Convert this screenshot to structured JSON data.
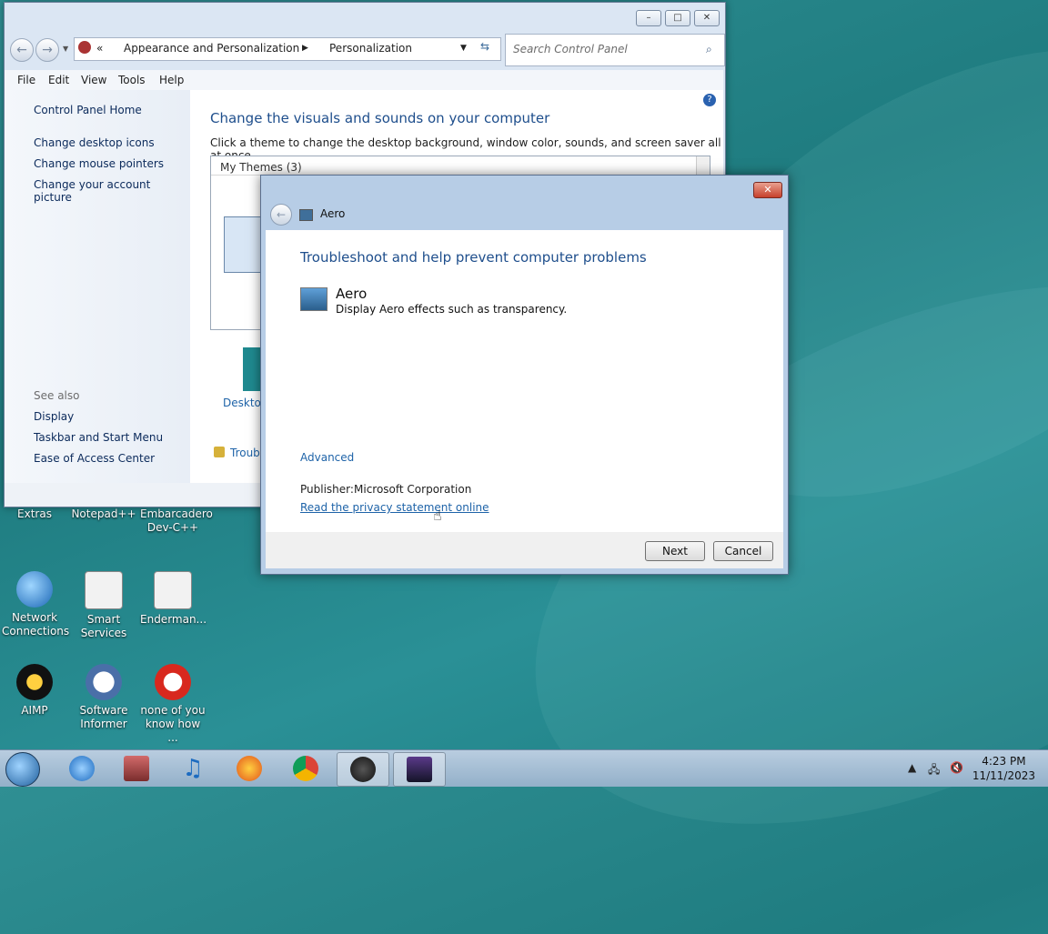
{
  "desktop": {
    "icons": [
      {
        "label": "Extras"
      },
      {
        "label": "Notepad++"
      },
      {
        "label": "Embarcadero Dev-C++"
      },
      {
        "label": "Network Connections"
      },
      {
        "label": "Smart Services"
      },
      {
        "label": "Enderman..."
      },
      {
        "label": "AIMP"
      },
      {
        "label": "Software Informer"
      },
      {
        "label": "none of you know how ..."
      }
    ]
  },
  "control_panel": {
    "address": {
      "crumb1": "Appearance and Personalization",
      "crumb2": "Personalization"
    },
    "search_placeholder": "Search Control Panel",
    "menu": [
      "File",
      "Edit",
      "View",
      "Tools",
      "Help"
    ],
    "left": {
      "home": "Control Panel Home",
      "links": [
        "Change desktop icons",
        "Change mouse pointers",
        "Change your account picture"
      ],
      "see_also_title": "See also",
      "see_also": [
        "Display",
        "Taskbar and Start Menu",
        "Ease of Access Center"
      ]
    },
    "main": {
      "heading": "Change the visuals and sounds on your computer",
      "subtext": "Click a theme to change the desktop background, window color, sounds, and screen saver all at once.",
      "my_themes": "My Themes (3)",
      "desktop_label": "Desktop",
      "troubleshoot_partial": "Troubl"
    }
  },
  "dialog": {
    "title": "Aero",
    "heading": "Troubleshoot and help prevent computer problems",
    "item_name": "Aero",
    "item_desc": "Display Aero effects such as transparency.",
    "advanced": "Advanced",
    "publisher_label": "Publisher:",
    "publisher_value": "Microsoft Corporation",
    "privacy_link": "Read the privacy statement online",
    "next_button": "Next",
    "cancel_button": "Cancel"
  },
  "taskbar": {
    "time": "4:23 PM",
    "date": "11/11/2023"
  }
}
